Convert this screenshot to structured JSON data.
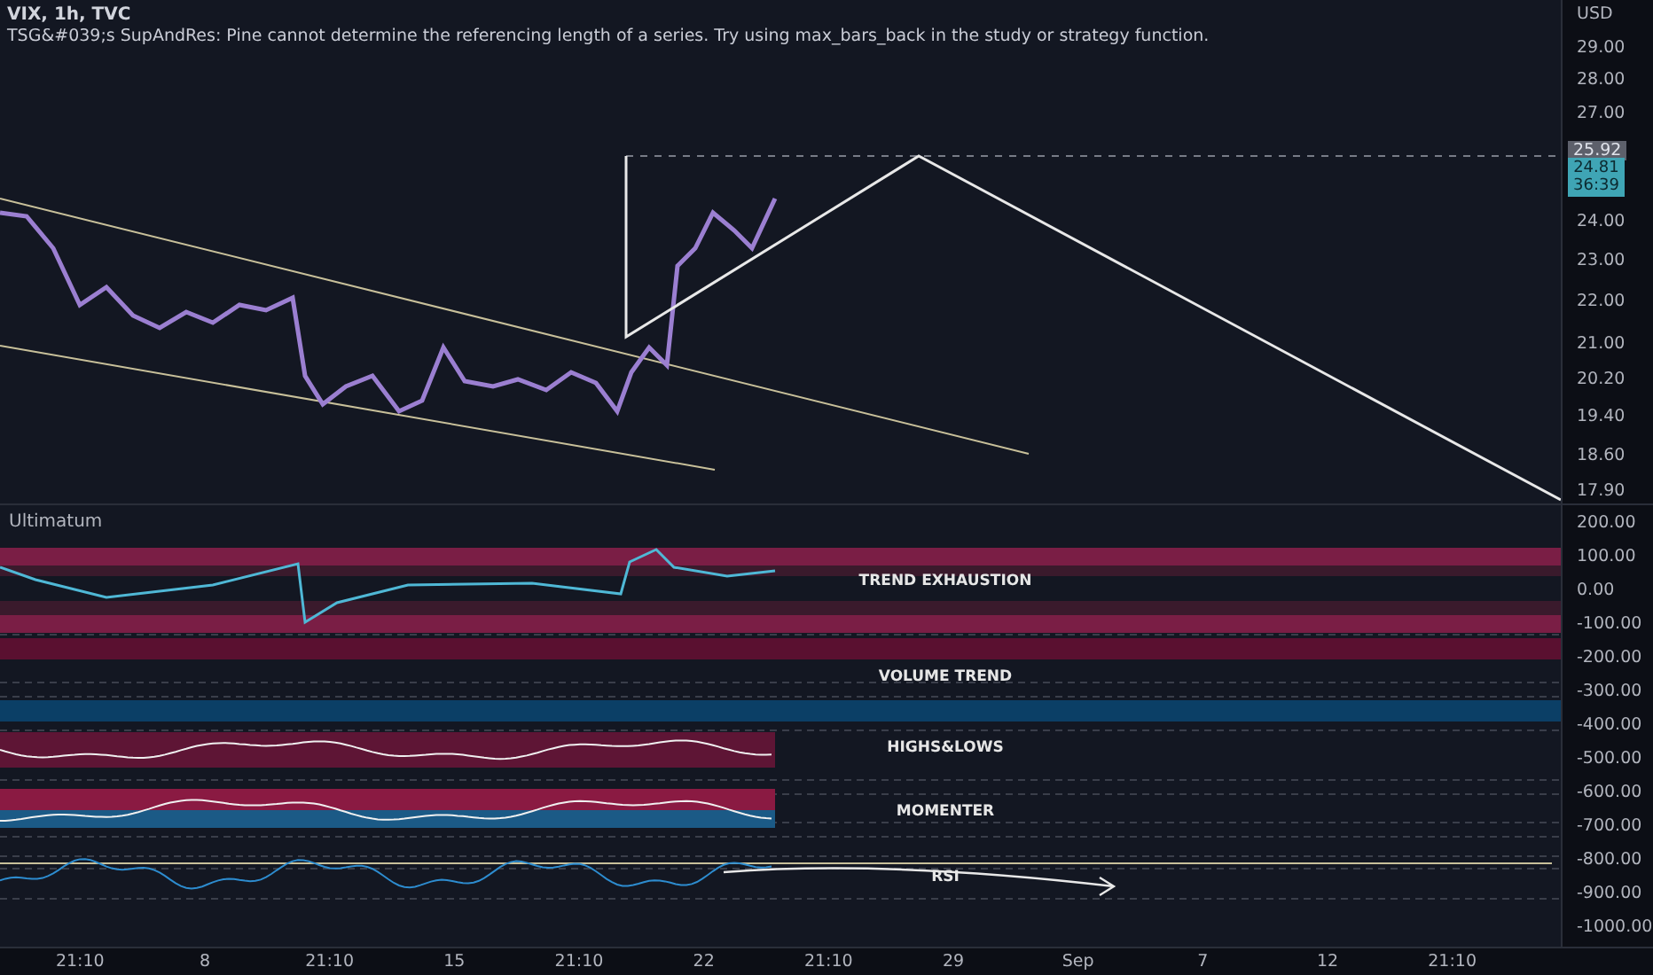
{
  "chart": {
    "title": "VIX, 1h, TVC",
    "error": "TSG&#039;s SupAndRes: Pine cannot determine the referencing length of a series. Try using max_bars_back in the study or strategy function."
  },
  "price_axis": {
    "currency": "USD",
    "labels": [
      "29.00",
      "28.00",
      "27.00",
      "24.00",
      "23.00",
      "22.00",
      "21.00",
      "20.20",
      "19.40",
      "18.60",
      "17.90"
    ],
    "marker": "25.92",
    "last_price": {
      "price": "24.81",
      "countdown": "36:39"
    }
  },
  "indicator": {
    "title": "Ultimatum",
    "sections": [
      "TREND EXHAUSTION",
      "VOLUME TREND",
      "HIGHS&LOWS",
      "MOMENTER",
      "RSI"
    ],
    "axis_labels": [
      "200.00",
      "100.00",
      "0.00",
      "-100.00",
      "-200.00",
      "-300.00",
      "-400.00",
      "-500.00",
      "-600.00",
      "-700.00",
      "-800.00",
      "-900.00",
      "-1000.00"
    ]
  },
  "time_axis": [
    "21:10",
    "8",
    "21:10",
    "15",
    "21:10",
    "22",
    "21:10",
    "29",
    "Sep",
    "7",
    "12",
    "21:10"
  ]
}
